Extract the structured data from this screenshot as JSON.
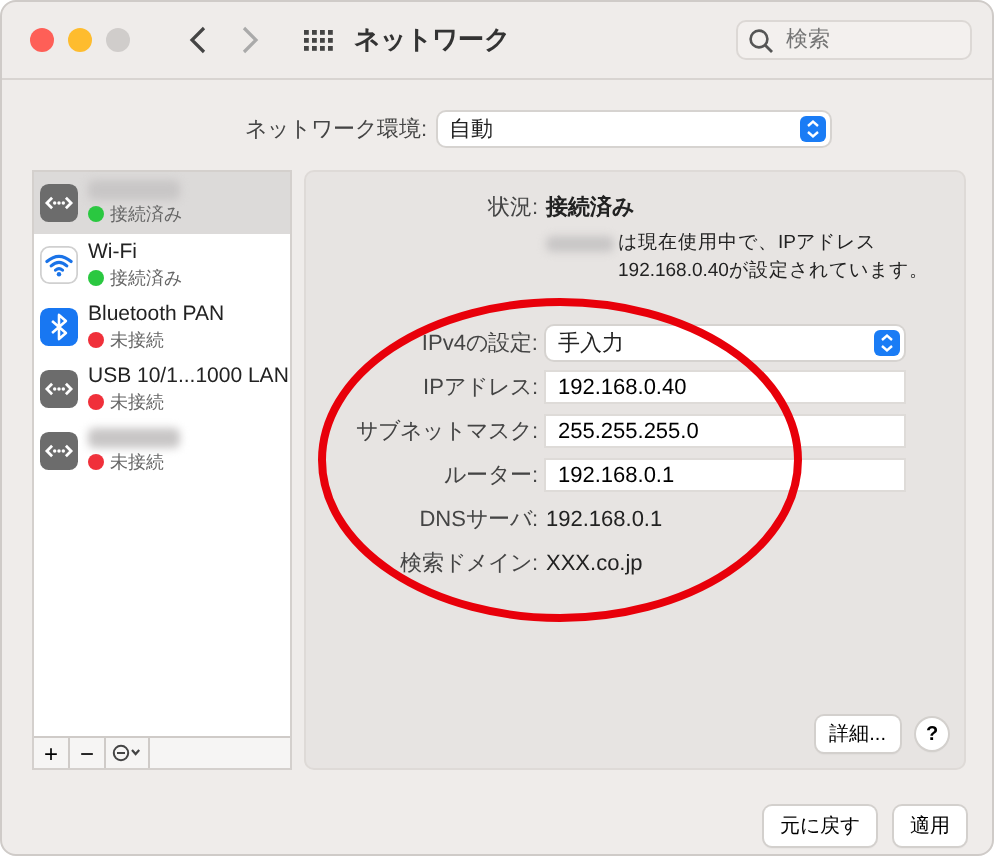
{
  "window": {
    "title": "ネットワーク",
    "search": {
      "placeholder": "検索"
    }
  },
  "location": {
    "label": "ネットワーク環境:",
    "value": "自動"
  },
  "services": [
    {
      "redacted": true,
      "kind": "ethernet",
      "status": "接続済み",
      "color": "#2ac840",
      "selected": true
    },
    {
      "name": "Wi-Fi",
      "redacted": false,
      "kind": "wifi",
      "status": "接続済み",
      "color": "#2ac840",
      "selected": false
    },
    {
      "name": "Bluetooth PAN",
      "redacted": false,
      "kind": "bluetooth",
      "status": "未接続",
      "color": "#f0303a",
      "selected": false
    },
    {
      "name": "USB 10/1...1000 LAN",
      "redacted": false,
      "kind": "ethernet",
      "status": "未接続",
      "color": "#f0303a",
      "selected": false
    },
    {
      "redacted": true,
      "kind": "ethernet",
      "status": "未接続",
      "color": "#f0303a",
      "selected": false
    }
  ],
  "detail": {
    "status_label": "状況:",
    "status_value": "接続済み",
    "message": "は現在使用中で、IPアドレス 192.168.0.40が設定されています。",
    "fields": [
      {
        "kind": "select",
        "label": "IPv4の設定:",
        "value": "手入力"
      },
      {
        "kind": "input",
        "label": "IPアドレス:",
        "value": "192.168.0.40"
      },
      {
        "kind": "input",
        "label": "サブネットマスク:",
        "value": "255.255.255.0"
      },
      {
        "kind": "input",
        "label": "ルーター:",
        "value": "192.168.0.1"
      },
      {
        "kind": "text",
        "label": "DNSサーバ:",
        "value": "192.168.0.1"
      },
      {
        "kind": "text",
        "label": "検索ドメイン:",
        "value": "XXX.co.jp"
      }
    ],
    "advanced_button": "詳細...",
    "help_button": "?"
  },
  "list_buttons": [
    "+",
    "−"
  ],
  "footer_buttons": [
    "元に戻す",
    "適用"
  ]
}
